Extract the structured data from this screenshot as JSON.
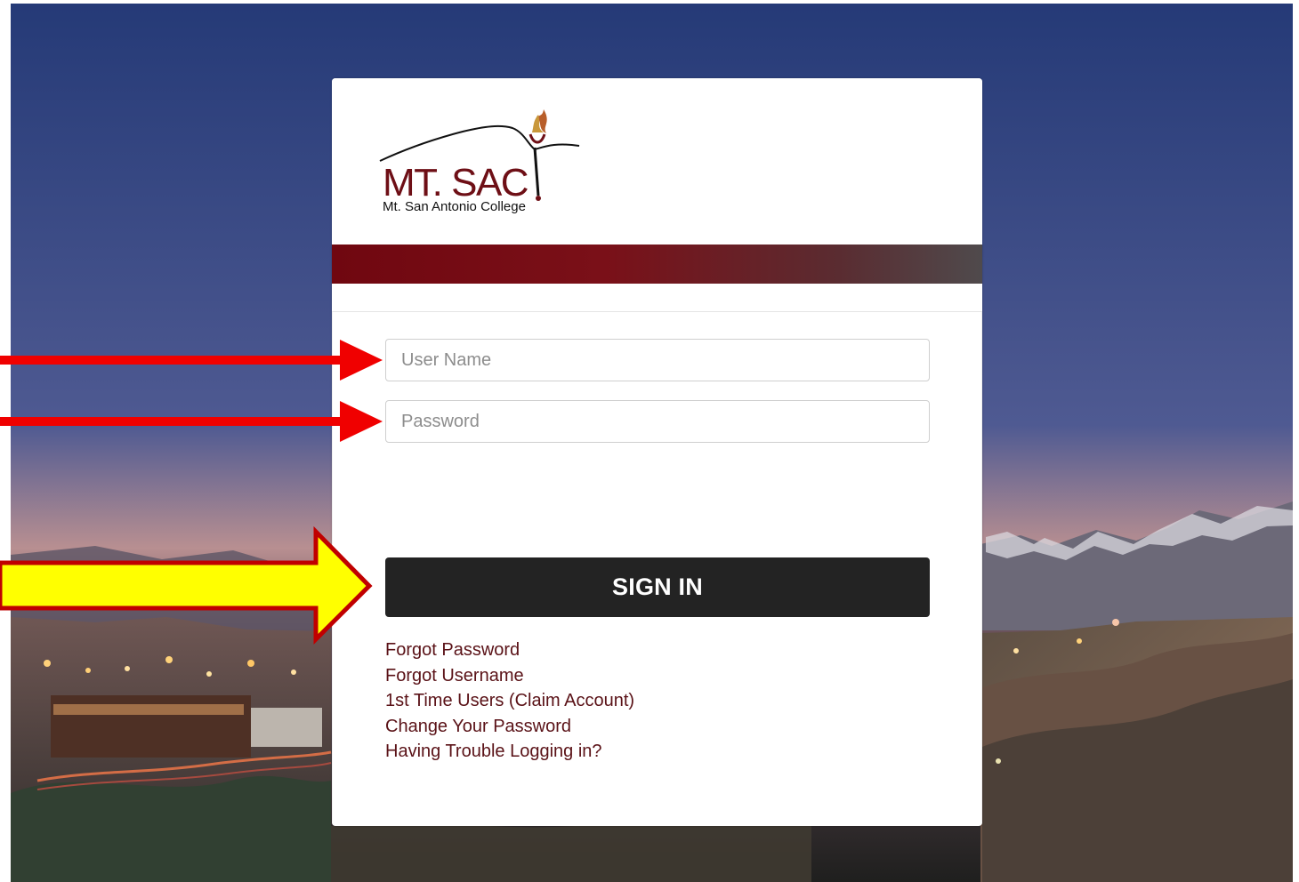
{
  "logo": {
    "name": "MT. SAC",
    "subtitle": "Mt. San Antonio College",
    "brand_color": "#6e0f16",
    "icon": "torch-mountain-icon"
  },
  "login_form": {
    "username": {
      "placeholder": "User Name",
      "value": ""
    },
    "password": {
      "placeholder": "Password",
      "value": ""
    },
    "sign_in_label": "SIGN IN"
  },
  "links": [
    "Forgot Password",
    "Forgot Username",
    "1st Time Users (Claim Account)",
    "Change Your Password",
    "Having Trouble Logging in?"
  ],
  "annotations": [
    {
      "name": "arrow",
      "target": "User Name",
      "color": "#f00000"
    },
    {
      "name": "arrow",
      "target": "Password",
      "color": "#f00000"
    },
    {
      "name": "arrow",
      "target": "SIGN IN",
      "color": "#ffff00",
      "outline_color": "#c00000"
    }
  ],
  "colors": {
    "sign_in_button": "#232323",
    "brand_band_start": "#700710",
    "brand_band_end": "#4f4a4c",
    "link": "#5a1217"
  }
}
